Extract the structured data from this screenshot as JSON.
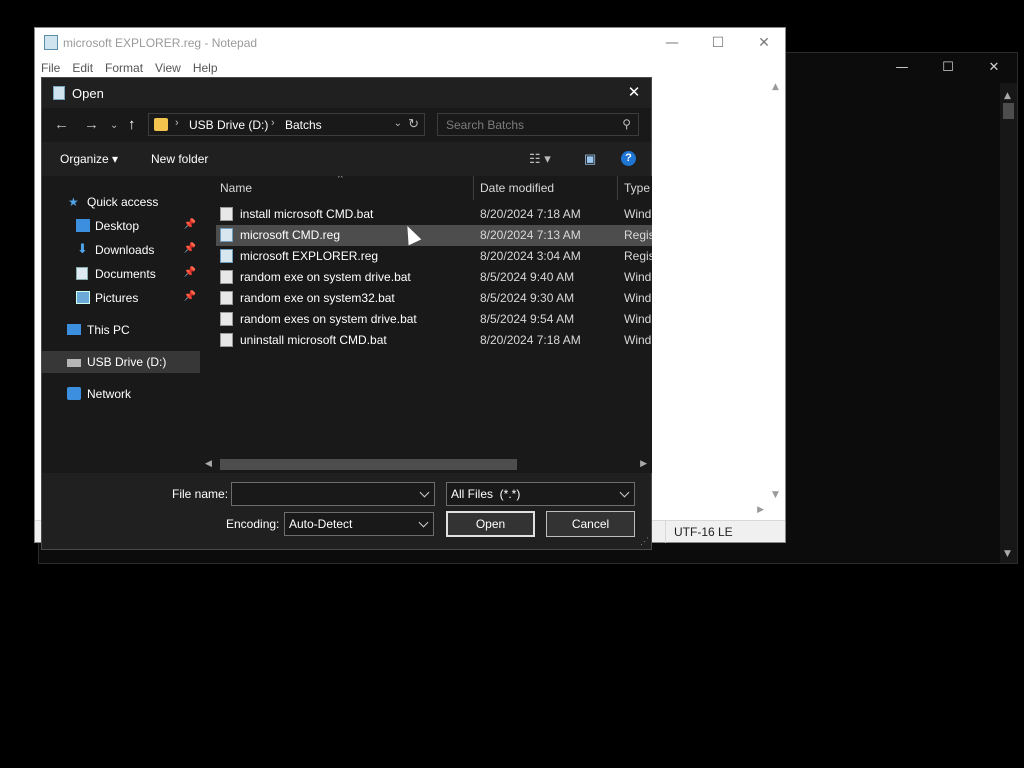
{
  "notepad": {
    "title": "microsoft EXPLORER.reg - Notepad",
    "menu": [
      "File",
      "Edit",
      "Format",
      "View",
      "Help"
    ],
    "status_encoding": "UTF-16 LE",
    "window_buttons": {
      "minimize": "—",
      "maximize": "☐",
      "close": "✕"
    }
  },
  "dialog": {
    "title": "Open",
    "breadcrumb": [
      "USB Drive (D:)",
      "Batchs"
    ],
    "search_placeholder": "Search Batchs",
    "toolbar": {
      "organize": "Organize ▾",
      "new_folder": "New folder"
    },
    "nav_pane": [
      {
        "label": "Quick access",
        "icon": "star-icon",
        "pinned": false
      },
      {
        "label": "Desktop",
        "icon": "desktop-icon",
        "pinned": true
      },
      {
        "label": "Downloads",
        "icon": "download-icon",
        "pinned": true
      },
      {
        "label": "Documents",
        "icon": "documents-icon",
        "pinned": true
      },
      {
        "label": "Pictures",
        "icon": "pictures-icon",
        "pinned": true
      },
      {
        "label": "This PC",
        "icon": "pc-icon",
        "pinned": false
      },
      {
        "label": "USB Drive (D:)",
        "icon": "drive-icon",
        "pinned": false,
        "selected": true
      },
      {
        "label": "Network",
        "icon": "network-icon",
        "pinned": false
      }
    ],
    "columns": {
      "name": "Name",
      "date": "Date modified",
      "type": "Type"
    },
    "files": [
      {
        "name": "install microsoft CMD.bat",
        "date": "8/20/2024 7:18 AM",
        "type": "Wind",
        "kind": "bat"
      },
      {
        "name": "microsoft CMD.reg",
        "date": "8/20/2024 7:13 AM",
        "type": "Regis",
        "kind": "reg",
        "hover": true
      },
      {
        "name": "microsoft EXPLORER.reg",
        "date": "8/20/2024 3:04 AM",
        "type": "Regis",
        "kind": "reg"
      },
      {
        "name": "random exe on system drive.bat",
        "date": "8/5/2024 9:40 AM",
        "type": "Wind",
        "kind": "bat"
      },
      {
        "name": "random exe on system32.bat",
        "date": "8/5/2024 9:30 AM",
        "type": "Wind",
        "kind": "bat"
      },
      {
        "name": "random exes on system drive.bat",
        "date": "8/5/2024 9:54 AM",
        "type": "Wind",
        "kind": "bat"
      },
      {
        "name": "uninstall microsoft CMD.bat",
        "date": "8/20/2024 7:18 AM",
        "type": "Wind",
        "kind": "bat"
      }
    ],
    "file_name_label": "File name:",
    "file_name_value": "",
    "file_type": "All Files  (*.*)",
    "encoding_label": "Encoding:",
    "encoding_value": "Auto-Detect",
    "open_label": "Open",
    "cancel_label": "Cancel",
    "close_symbol": "✕"
  }
}
